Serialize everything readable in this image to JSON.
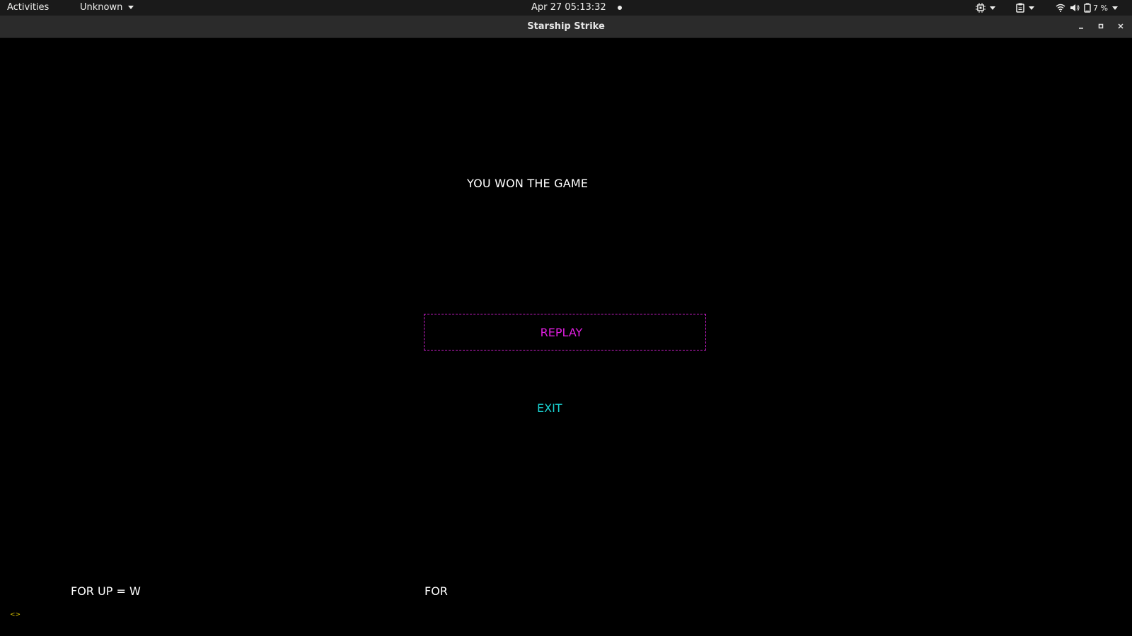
{
  "topbar": {
    "activities": "Activities",
    "app_menu": "Unknown",
    "clock": "Apr 27  05:13:32",
    "battery_percent": "7 %",
    "icons": [
      "cpu-icon",
      "clipboard-icon",
      "wifi-icon",
      "volume-icon",
      "battery-icon"
    ]
  },
  "window": {
    "title": "Starship Strike",
    "controls": [
      "minimize",
      "maximize",
      "close"
    ]
  },
  "game": {
    "win_message": "YOU WON THE GAME",
    "replay_label": "REPLAY",
    "exit_label": "EXIT",
    "help_left": "FOR UP = W",
    "help_mid": "FOR",
    "colors": {
      "background": "#000000",
      "replay": "#e01ee0",
      "replay_border": "#c81dc8",
      "exit": "#1ad4d4",
      "text": "#ffffff"
    }
  }
}
